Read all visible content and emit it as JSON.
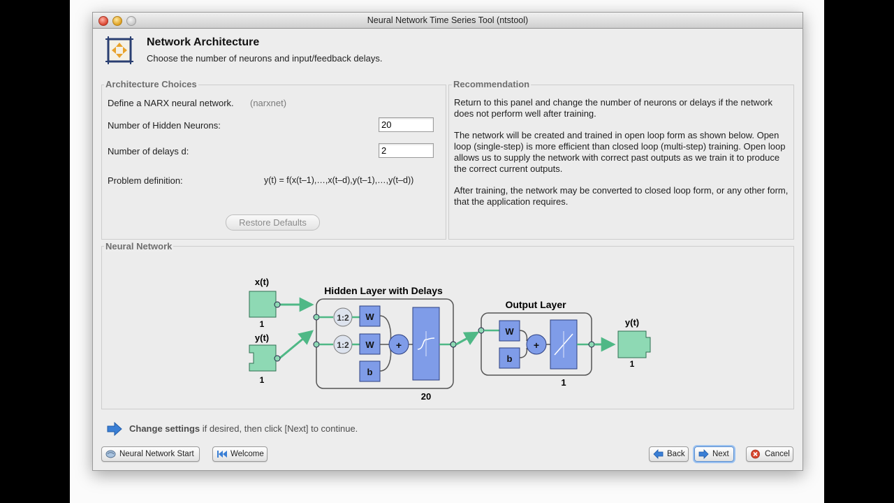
{
  "window": {
    "title": "Neural Network Time Series Tool (ntstool)"
  },
  "header": {
    "title": "Network Architecture",
    "subtitle": "Choose the number of neurons and input/feedback delays."
  },
  "architecture": {
    "panel_label": "Architecture Choices",
    "define_text": "Define a NARX neural network.",
    "define_note": "(narxnet)",
    "hidden_neurons_label": "Number of Hidden Neurons:",
    "hidden_neurons_value": "20",
    "delays_label": "Number of delays d:",
    "delays_value": "2",
    "problem_label": "Problem definition:",
    "problem_formula": "y(t) = f(x(t–1),…,x(t–d),y(t–1),…,y(t–d))",
    "restore_label": "Restore Defaults"
  },
  "recommendation": {
    "panel_label": "Recommendation",
    "paragraph1": "Return to this panel and change the number of neurons or delays if the network does not perform well after training.",
    "paragraph2": "The network will be created and trained in open loop form as shown below. Open loop (single-step) is more efficient than closed loop (multi-step) training. Open loop allows us to supply the network with correct past outputs as we train it to produce the correct current outputs.",
    "paragraph3": "After training, the network may be converted to closed loop form, or any other form, that the application requires."
  },
  "network": {
    "panel_label": "Neural Network",
    "input_x_label": "x(t)",
    "input_x_size": "1",
    "input_y_label": "y(t)",
    "input_y_size": "1",
    "hidden_title": "Hidden Layer with Delays",
    "delay1": "1:2",
    "delay2": "1:2",
    "weight_label": "W",
    "bias_label": "b",
    "sum_label": "+",
    "hidden_size": "20",
    "output_title": "Output Layer",
    "output_size": "1",
    "output_label": "y(t)",
    "output_port_size": "1"
  },
  "footer": {
    "hint_bold": "Change settings",
    "hint_rest": " if desired, then click [Next] to continue.",
    "start_button": "Neural Network Start",
    "welcome_button": "Welcome",
    "back_button": "Back",
    "next_button": "Next",
    "cancel_button": "Cancel"
  },
  "colors": {
    "block_green": "#8ed9b4",
    "block_blue": "#7f9ce8",
    "accent_blue": "#3a7fd5"
  }
}
